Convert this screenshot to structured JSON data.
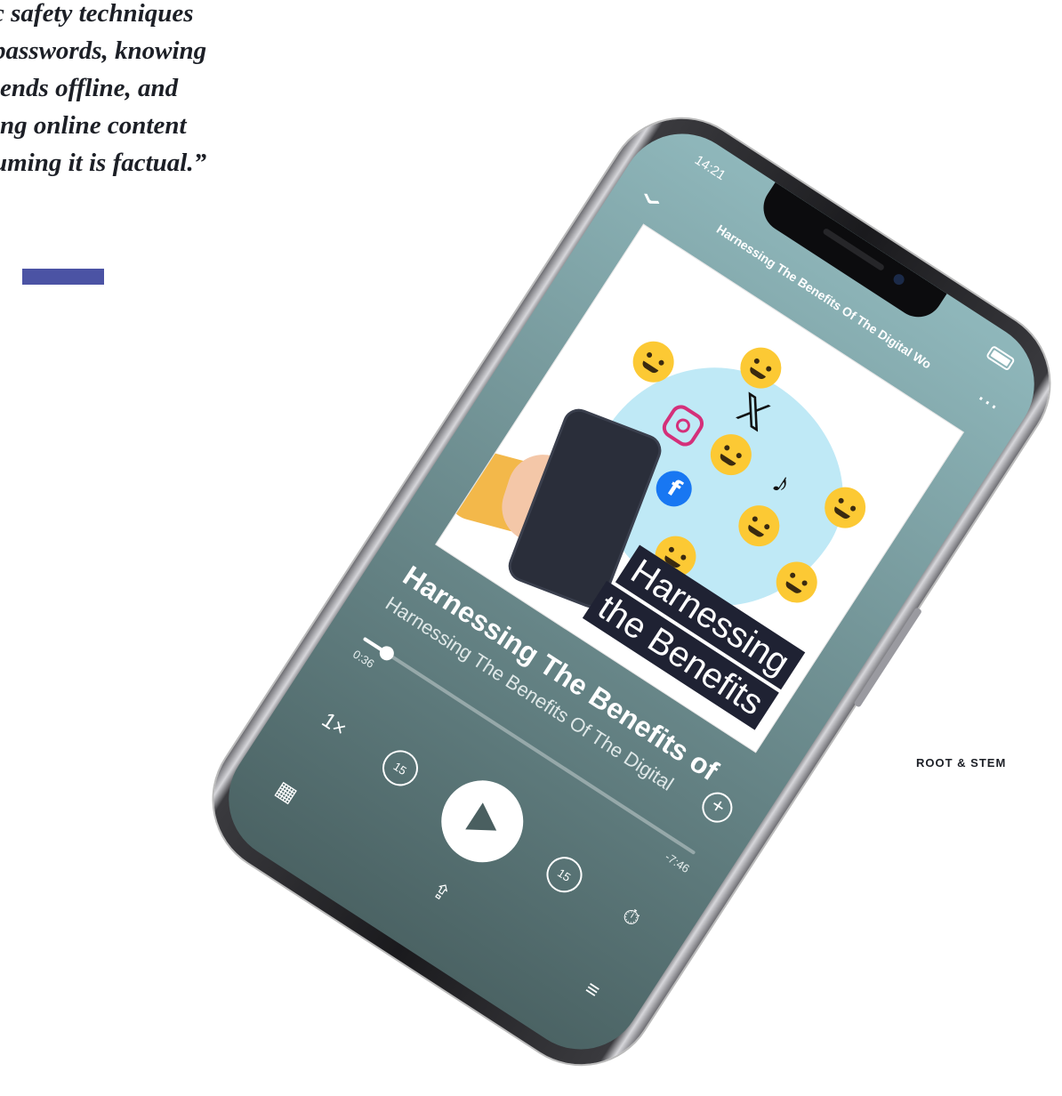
{
  "article": {
    "quote_text": "c safety techniques\npasswords, knowing\niends offline, and\ning online content\numing it is factual.”",
    "brand": "ROOT & STEM"
  },
  "phone": {
    "status": {
      "time": "14:21"
    },
    "header": {
      "title": "Harnessing The Benefits Of The Digital Wo"
    },
    "artwork": {
      "caption_line1": "Harnessing",
      "caption_line2": "the Benefits"
    },
    "track": {
      "title": "Harnessing The Benefits of",
      "subtitle": "Harnessing The Benefits Of The Digital"
    },
    "player": {
      "elapsed": "0:36",
      "remaining": "-7:46",
      "progress_fraction": 0.07,
      "speed_label": "1×",
      "rewind_label": "15",
      "forward_label": "15"
    }
  },
  "colors": {
    "accent_bar": "#4b53a4",
    "screen_top": "#8fb7bb",
    "screen_bottom": "#4b6364"
  }
}
